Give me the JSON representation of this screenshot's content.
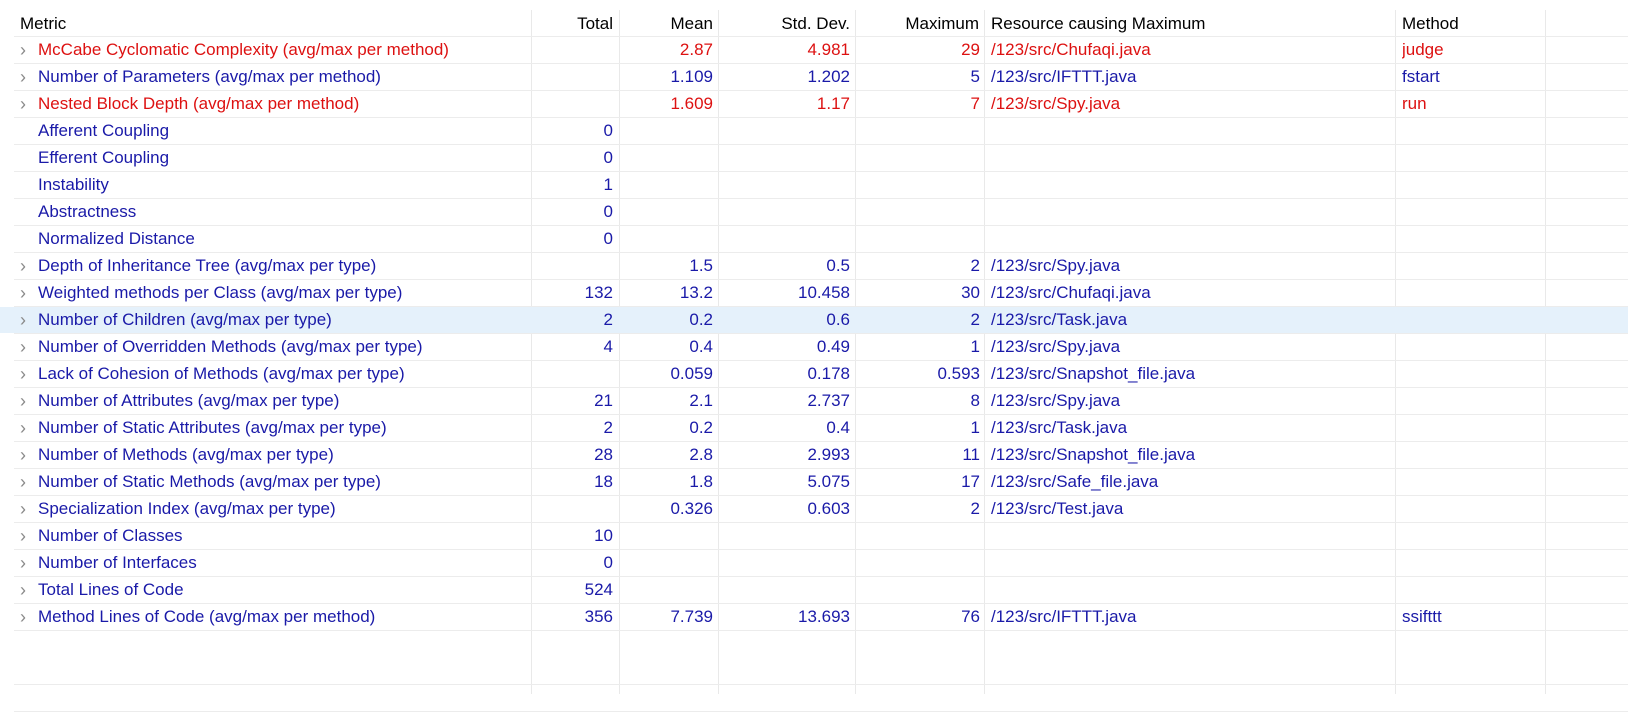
{
  "columns": [
    "Metric",
    "Total",
    "Mean",
    "Std. Dev.",
    "Maximum",
    "Resource causing Maximum",
    "Method"
  ],
  "colors": {
    "normal": "#1a1aa8",
    "warning": "#dd1111",
    "selected_row": "#e5f1fb"
  },
  "icons": {
    "expander": "chevron-right-icon"
  },
  "rows": [
    {
      "metric": "McCabe Cyclomatic Complexity (avg/max per method)",
      "total": "",
      "mean": "2.87",
      "std": "4.981",
      "max": "29",
      "resource": "/123/src/Chufaqi.java",
      "method": "judge",
      "color": "red",
      "expandable": true
    },
    {
      "metric": "Number of Parameters (avg/max per method)",
      "total": "",
      "mean": "1.109",
      "std": "1.202",
      "max": "5",
      "resource": "/123/src/IFTTT.java",
      "method": "fstart",
      "color": "blue",
      "expandable": true
    },
    {
      "metric": "Nested Block Depth (avg/max per method)",
      "total": "",
      "mean": "1.609",
      "std": "1.17",
      "max": "7",
      "resource": "/123/src/Spy.java",
      "method": "run",
      "color": "red",
      "expandable": true
    },
    {
      "metric": "Afferent Coupling",
      "total": "0",
      "mean": "",
      "std": "",
      "max": "",
      "resource": "",
      "method": "",
      "color": "blue",
      "expandable": false
    },
    {
      "metric": "Efferent Coupling",
      "total": "0",
      "mean": "",
      "std": "",
      "max": "",
      "resource": "",
      "method": "",
      "color": "blue",
      "expandable": false
    },
    {
      "metric": "Instability",
      "total": "1",
      "mean": "",
      "std": "",
      "max": "",
      "resource": "",
      "method": "",
      "color": "blue",
      "expandable": false
    },
    {
      "metric": "Abstractness",
      "total": "0",
      "mean": "",
      "std": "",
      "max": "",
      "resource": "",
      "method": "",
      "color": "blue",
      "expandable": false
    },
    {
      "metric": "Normalized Distance",
      "total": "0",
      "mean": "",
      "std": "",
      "max": "",
      "resource": "",
      "method": "",
      "color": "blue",
      "expandable": false
    },
    {
      "metric": "Depth of Inheritance Tree (avg/max per type)",
      "total": "",
      "mean": "1.5",
      "std": "0.5",
      "max": "2",
      "resource": "/123/src/Spy.java",
      "method": "",
      "color": "blue",
      "expandable": true
    },
    {
      "metric": "Weighted methods per Class (avg/max per type)",
      "total": "132",
      "mean": "13.2",
      "std": "10.458",
      "max": "30",
      "resource": "/123/src/Chufaqi.java",
      "method": "",
      "color": "blue",
      "expandable": true
    },
    {
      "metric": "Number of Children (avg/max per type)",
      "total": "2",
      "mean": "0.2",
      "std": "0.6",
      "max": "2",
      "resource": "/123/src/Task.java",
      "method": "",
      "color": "blue",
      "expandable": true,
      "selected": true
    },
    {
      "metric": "Number of Overridden Methods (avg/max per type)",
      "total": "4",
      "mean": "0.4",
      "std": "0.49",
      "max": "1",
      "resource": "/123/src/Spy.java",
      "method": "",
      "color": "blue",
      "expandable": true
    },
    {
      "metric": "Lack of Cohesion of Methods (avg/max per type)",
      "total": "",
      "mean": "0.059",
      "std": "0.178",
      "max": "0.593",
      "resource": "/123/src/Snapshot_file.java",
      "method": "",
      "color": "blue",
      "expandable": true
    },
    {
      "metric": "Number of Attributes (avg/max per type)",
      "total": "21",
      "mean": "2.1",
      "std": "2.737",
      "max": "8",
      "resource": "/123/src/Spy.java",
      "method": "",
      "color": "blue",
      "expandable": true
    },
    {
      "metric": "Number of Static Attributes (avg/max per type)",
      "total": "2",
      "mean": "0.2",
      "std": "0.4",
      "max": "1",
      "resource": "/123/src/Task.java",
      "method": "",
      "color": "blue",
      "expandable": true
    },
    {
      "metric": "Number of Methods (avg/max per type)",
      "total": "28",
      "mean": "2.8",
      "std": "2.993",
      "max": "11",
      "resource": "/123/src/Snapshot_file.java",
      "method": "",
      "color": "blue",
      "expandable": true
    },
    {
      "metric": "Number of Static Methods (avg/max per type)",
      "total": "18",
      "mean": "1.8",
      "std": "5.075",
      "max": "17",
      "resource": "/123/src/Safe_file.java",
      "method": "",
      "color": "blue",
      "expandable": true
    },
    {
      "metric": "Specialization Index (avg/max per type)",
      "total": "",
      "mean": "0.326",
      "std": "0.603",
      "max": "2",
      "resource": "/123/src/Test.java",
      "method": "",
      "color": "blue",
      "expandable": true
    },
    {
      "metric": "Number of Classes",
      "total": "10",
      "mean": "",
      "std": "",
      "max": "",
      "resource": "",
      "method": "",
      "color": "blue",
      "expandable": true
    },
    {
      "metric": "Number of Interfaces",
      "total": "0",
      "mean": "",
      "std": "",
      "max": "",
      "resource": "",
      "method": "",
      "color": "blue",
      "expandable": true
    },
    {
      "metric": "Total Lines of Code",
      "total": "524",
      "mean": "",
      "std": "",
      "max": "",
      "resource": "",
      "method": "",
      "color": "blue",
      "expandable": true
    },
    {
      "metric": "Method Lines of Code (avg/max per method)",
      "total": "356",
      "mean": "7.739",
      "std": "13.693",
      "max": "76",
      "resource": "/123/src/IFTTT.java",
      "method": "ssifttt",
      "color": "blue",
      "expandable": true
    }
  ]
}
